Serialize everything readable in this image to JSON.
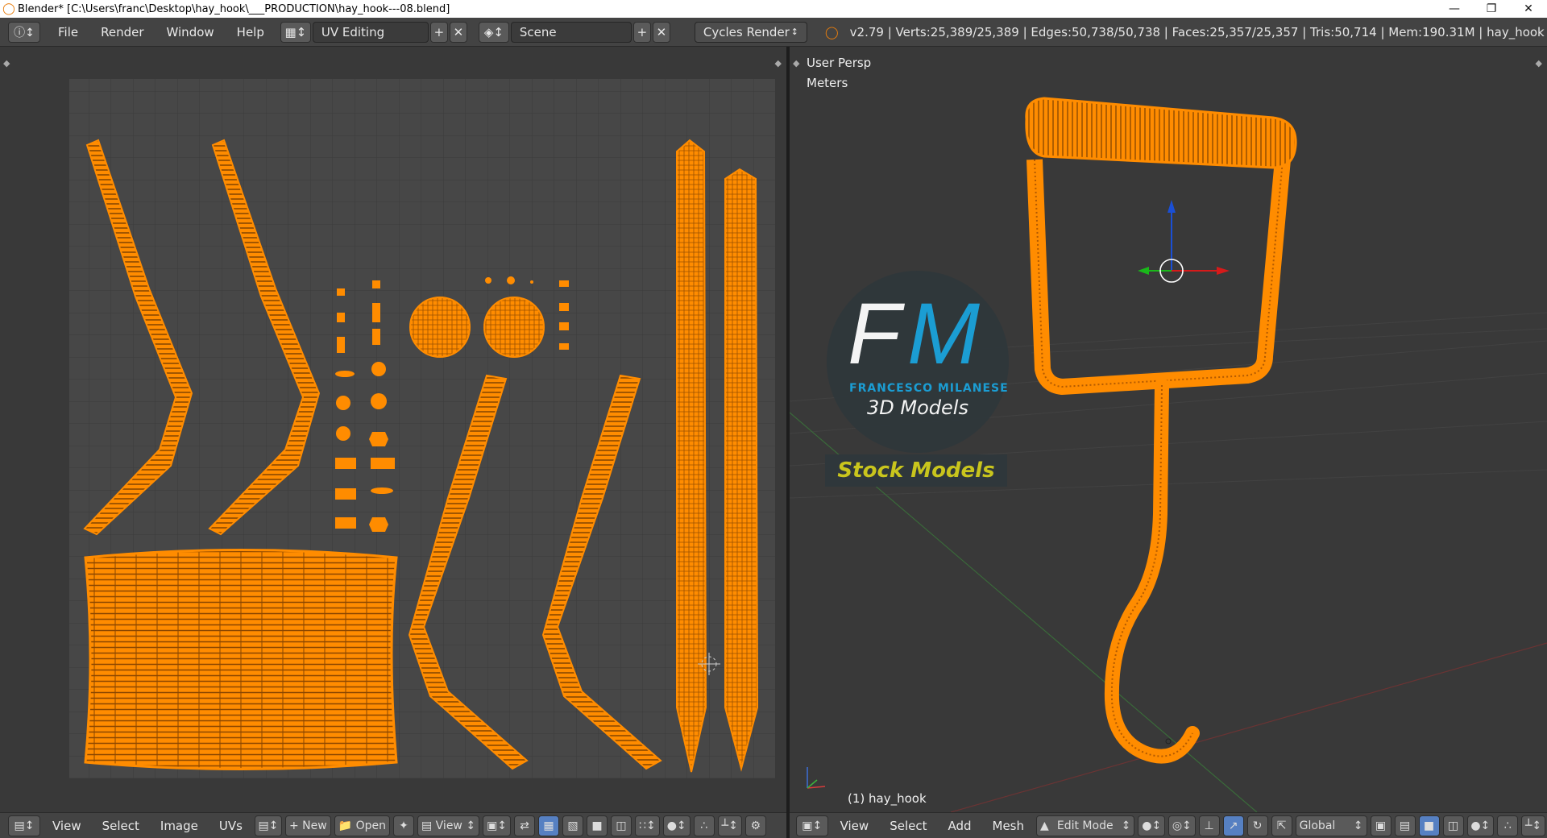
{
  "window": {
    "title": "Blender* [C:\\Users\\franc\\Desktop\\hay_hook\\___PRODUCTION\\hay_hook---08.blend]",
    "minimize": "—",
    "restore": "❐",
    "close": "✕"
  },
  "infobar": {
    "menu": [
      "File",
      "Render",
      "Window",
      "Help"
    ],
    "screen_layout": "UV Editing",
    "scene": "Scene",
    "render_engine": "Cycles Render",
    "stats": "v2.79 | Verts:25,389/25,389 | Edges:50,738/50,738 | Faces:25,357/25,357 | Tris:50,714 | Mem:190.31M | hay_hook"
  },
  "viewport": {
    "view_name": "User Persp",
    "units": "Meters",
    "object_label": "(1) hay_hook",
    "watermark": {
      "initials_f": "F",
      "initials_m": "M",
      "brand": "FRANCESCO MILANESE",
      "sub": "3D Models",
      "tag": "Stock Models"
    }
  },
  "uv_footer": {
    "view": "View",
    "select": "Select",
    "image": "Image",
    "uvs": "UVs",
    "new": "New",
    "open": "Open",
    "view2": "View"
  },
  "vp_footer": {
    "view": "View",
    "select": "Select",
    "add": "Add",
    "mesh": "Mesh",
    "mode": "Edit Mode",
    "orientation": "Global"
  },
  "colors": {
    "mesh": "#ff8c00",
    "mesh_dark": "#b35a00",
    "bg": "#393939",
    "grid_bg": "#454545",
    "grid_line": "#3a3a3a",
    "accent_blue": "#5680c2",
    "logo_blue": "#1aa3dc",
    "logo_green": "#c9c51d"
  }
}
